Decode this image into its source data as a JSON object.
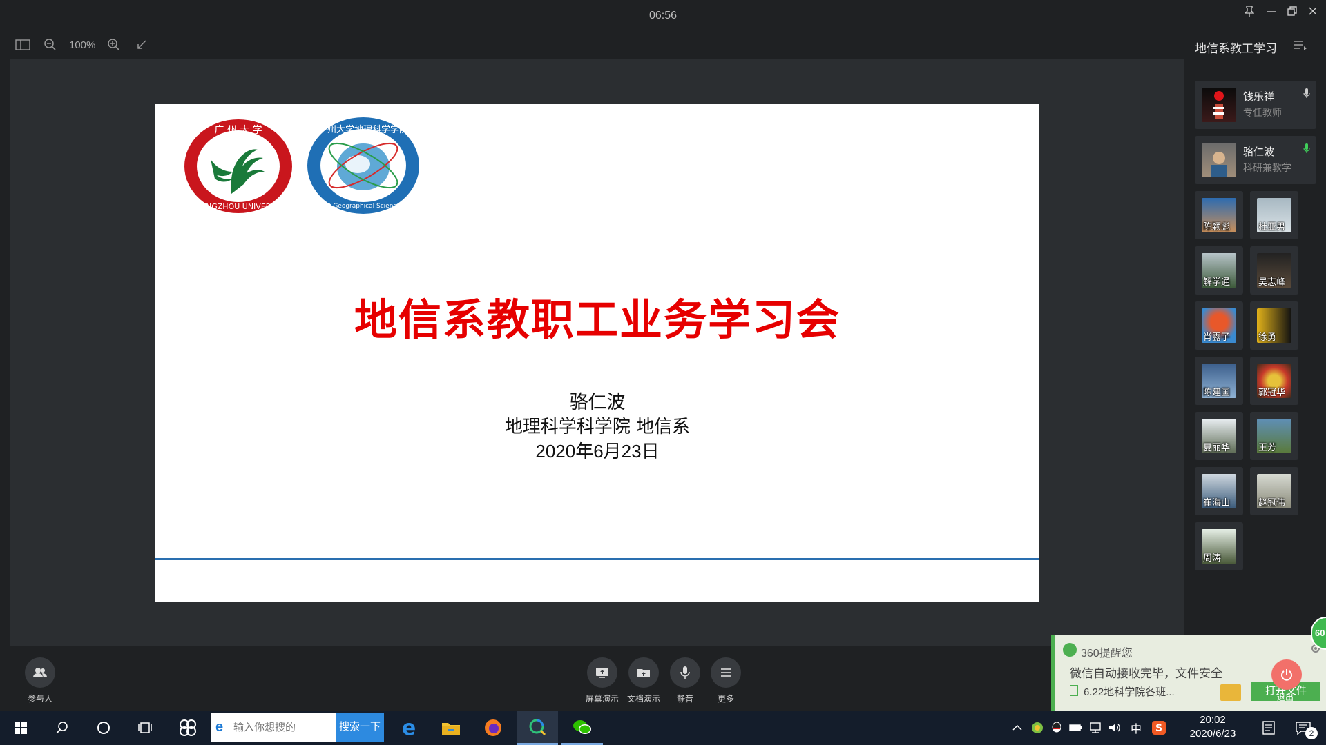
{
  "timer": "06:56",
  "toolbar": {
    "zoom": "100%"
  },
  "slide": {
    "title": "地信系教职工业务学习会",
    "presenter": "骆仁波",
    "department": "地理科学科学院 地信系",
    "date": "2020年6月23日",
    "logo1_text": "广州大学 GUANGZHOU UNIVERSITY",
    "logo2_text": "广州大学地理科学学院 School of Geographical Sciences GZHU"
  },
  "panel": {
    "meeting_title": "地信系教工学习",
    "hosts": [
      {
        "name": "钱乐祥",
        "role": "专任教师"
      },
      {
        "name": "骆仁波",
        "role": "科研兼教学"
      }
    ],
    "participants": [
      "陈颖彪",
      "杜亚男",
      "解学通",
      "吴志峰",
      "肖露子",
      "徐勇",
      "陈建国",
      "郭冠华",
      "夏丽华",
      "王芳",
      "崔海山",
      "赵冠伟",
      "周涛"
    ]
  },
  "controls": {
    "participants": "参与人",
    "screen_share": "屏幕演示",
    "doc_share": "文档演示",
    "mute": "静音",
    "more": "更多"
  },
  "popup": {
    "title": "360提醒您",
    "message": "微信自动接收完毕，文件安全",
    "file": "6.22地科学院各班...",
    "open_file": "打开文件",
    "exit": "退出",
    "badge": "60"
  },
  "taskbar": {
    "search_placeholder": "输入你想搜的",
    "search_button": "搜索一下",
    "ime": "中",
    "time": "20:02",
    "date": "2020/6/23",
    "notif_count": "2"
  },
  "colors": {
    "accent_red": "#e60000",
    "rule_blue": "#2a6fb0",
    "green": "#4caf50"
  }
}
